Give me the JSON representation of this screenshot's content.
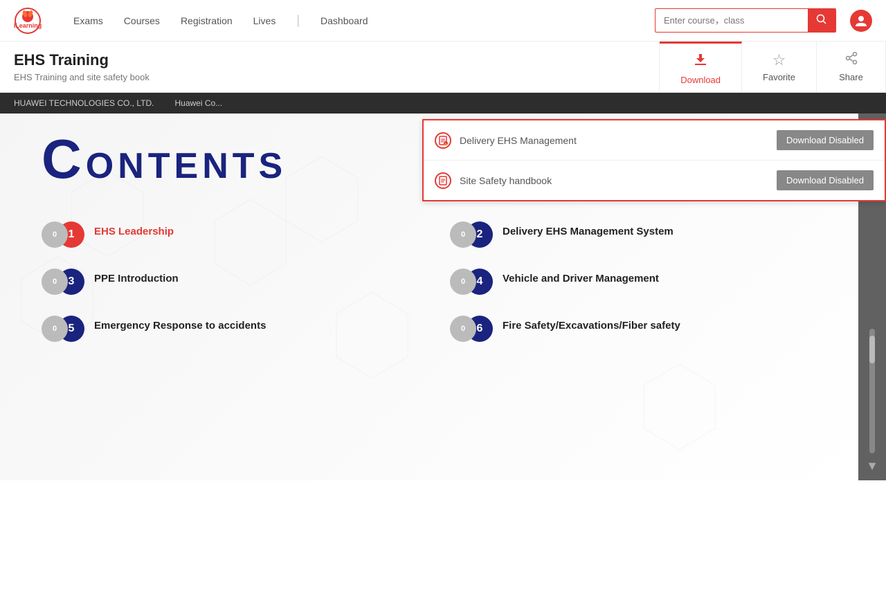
{
  "header": {
    "logo_text": "iLearning",
    "nav": {
      "exams": "Exams",
      "courses": "Courses",
      "registration": "Registration",
      "lives": "Lives",
      "dashboard": "Dashboard"
    },
    "search_placeholder": "Enter course，class"
  },
  "course": {
    "title": "EHS Training",
    "subtitle": "EHS Training and site safety book",
    "actions": {
      "download": "Download",
      "favorite": "Favorite",
      "share": "Share"
    }
  },
  "company_bar": {
    "company": "HUAWEI TECHNOLOGIES CO., LTD.",
    "description": "Huawei Co..."
  },
  "download_dropdown": {
    "items": [
      {
        "name": "Delivery EHS Management",
        "btn_label": "Download Disabled"
      },
      {
        "name": "Site Safety handbook",
        "btn_label": "Download Disabled"
      }
    ]
  },
  "book": {
    "contents_title": "ONTENTS",
    "contents_big_c": "C",
    "items": [
      {
        "num": "1",
        "label": "EHS Leadership",
        "red": true
      },
      {
        "num": "2",
        "label": "Delivery EHS Management System",
        "red": false
      },
      {
        "num": "3",
        "label": "PPE Introduction",
        "red": false
      },
      {
        "num": "4",
        "label": "Vehicle and Driver Management",
        "red": false
      },
      {
        "num": "5",
        "label": "Emergency Response to accidents",
        "red": false
      },
      {
        "num": "6",
        "label": "Fire Safety/Excavations/Fiber safety",
        "red": false
      }
    ]
  },
  "icons": {
    "search": "🔍",
    "download": "⬇",
    "favorite": "☆",
    "share": "⬆",
    "file": "B",
    "user": "U"
  }
}
